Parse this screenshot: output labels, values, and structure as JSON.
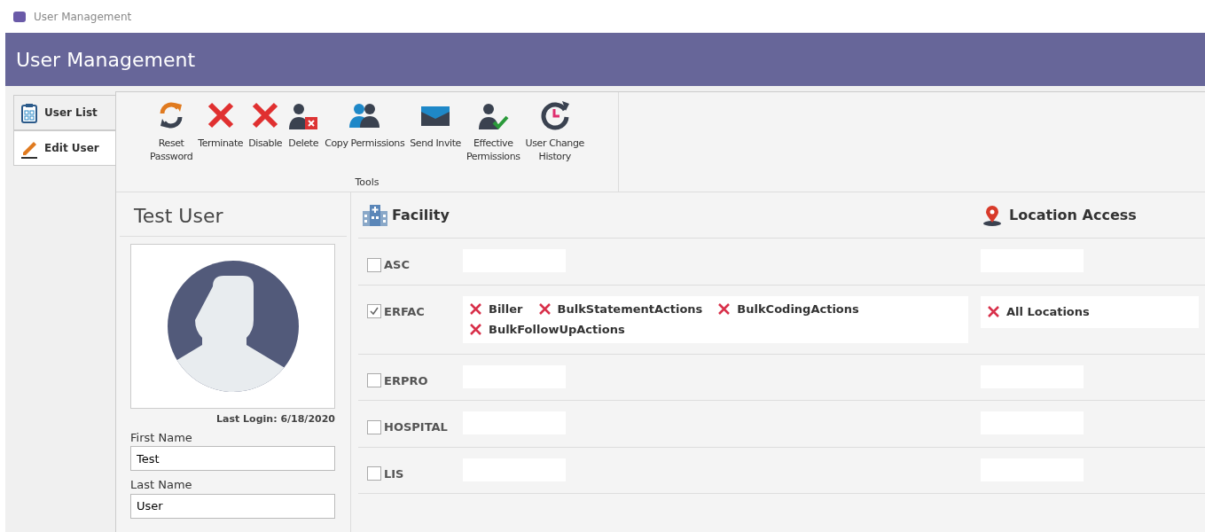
{
  "window": {
    "title": "User Management"
  },
  "header": {
    "title": "User Management"
  },
  "side_tabs": [
    {
      "label": "User List",
      "kind": "clipboard",
      "selected": false
    },
    {
      "label": "Edit User",
      "kind": "pencil",
      "selected": true
    }
  ],
  "toolbar": {
    "group_label": "Tools",
    "tools": [
      {
        "label": "Reset\nPassword",
        "kind": "refresh"
      },
      {
        "label": "Terminate",
        "kind": "x"
      },
      {
        "label": "Disable",
        "kind": "x"
      },
      {
        "label": "Delete",
        "kind": "userdelete"
      },
      {
        "label": "Copy Permissions",
        "kind": "users"
      },
      {
        "label": "Send Invite",
        "kind": "mail"
      },
      {
        "label": "Effective\nPermissions",
        "kind": "usercheck"
      },
      {
        "label": "User Change\nHistory",
        "kind": "history"
      }
    ]
  },
  "profile": {
    "name": "Test User",
    "last_login": "Last Login: 6/18/2020",
    "fields": [
      {
        "label": "First Name",
        "value": "Test"
      },
      {
        "label": "Last Name",
        "value": "User"
      }
    ]
  },
  "facilities": {
    "facility_heading": "Facility",
    "location_heading": "Location Access",
    "rows": [
      {
        "name": "ASC",
        "checked": false,
        "roles": [],
        "locations": []
      },
      {
        "name": "ERFAC",
        "checked": true,
        "roles": [
          "Biller",
          "BulkStatementActions",
          "BulkCodingActions",
          "BulkFollowUpActions"
        ],
        "locations": [
          "All Locations"
        ]
      },
      {
        "name": "ERPRO",
        "checked": false,
        "roles": [],
        "locations": []
      },
      {
        "name": "HOSPITAL",
        "checked": false,
        "roles": [],
        "locations": []
      },
      {
        "name": "LIS",
        "checked": false,
        "roles": [],
        "locations": []
      }
    ]
  }
}
